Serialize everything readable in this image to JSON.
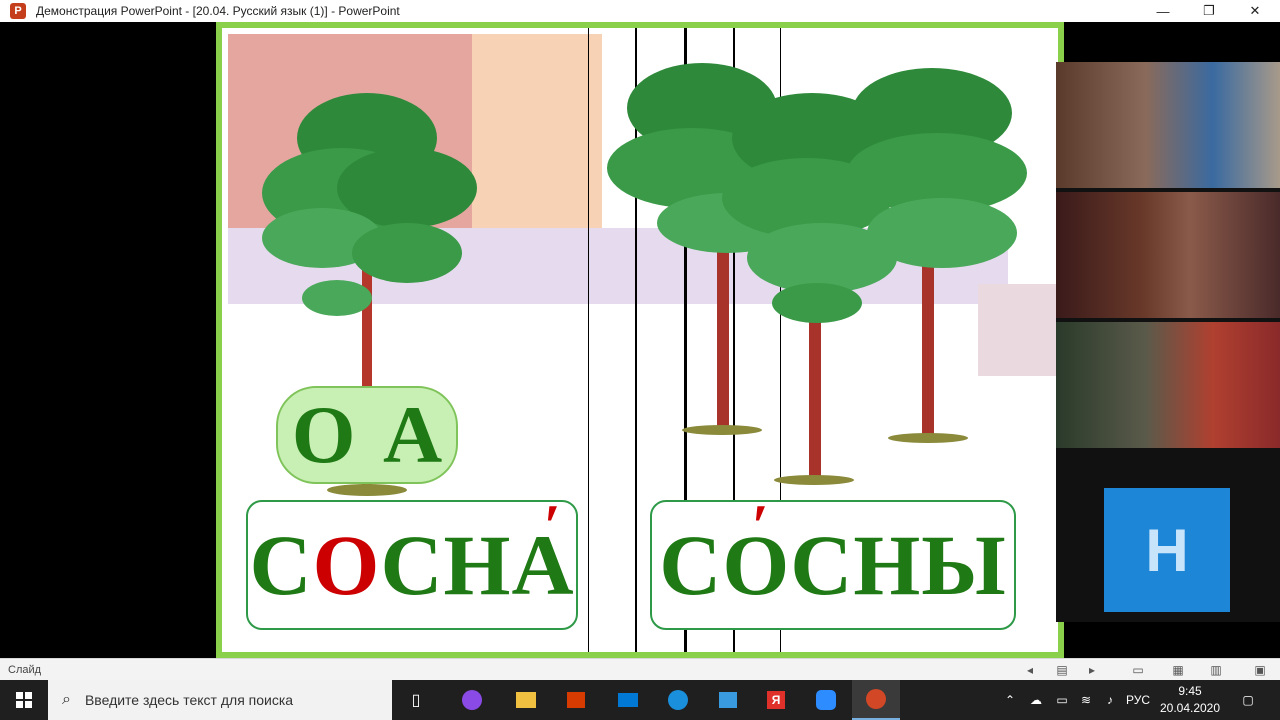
{
  "window": {
    "title": "Демонстрация PowerPoint - [20.04. Русский язык (1)] - PowerPoint",
    "minimize": "—",
    "restore": "❐",
    "close": "✕"
  },
  "slide": {
    "letters": [
      "О",
      "А"
    ],
    "word1": {
      "parts": [
        "С",
        "О",
        "СНА"
      ],
      "stress_mark": "′"
    },
    "word2": {
      "parts": [
        "С",
        "О",
        "СНЫ"
      ],
      "stress_mark": "′"
    },
    "colors": {
      "green_text": "#1f7a15",
      "red_letter": "#cc0000",
      "frame": "#8bd04a"
    }
  },
  "video": {
    "participant_initial": "Н"
  },
  "statusbar": {
    "label": "Слайд"
  },
  "taskbar": {
    "search_placeholder": "Введите здесь текст для поиска",
    "language": "РУС",
    "time": "9:45",
    "date": "20.04.2020",
    "apps": [
      "task-view-icon",
      "alice-icon",
      "file-explorer-icon",
      "store-icon",
      "mail-icon",
      "edge-icon",
      "app-icon",
      "yandex-icon",
      "zoom-icon",
      "powerpoint-icon"
    ]
  }
}
